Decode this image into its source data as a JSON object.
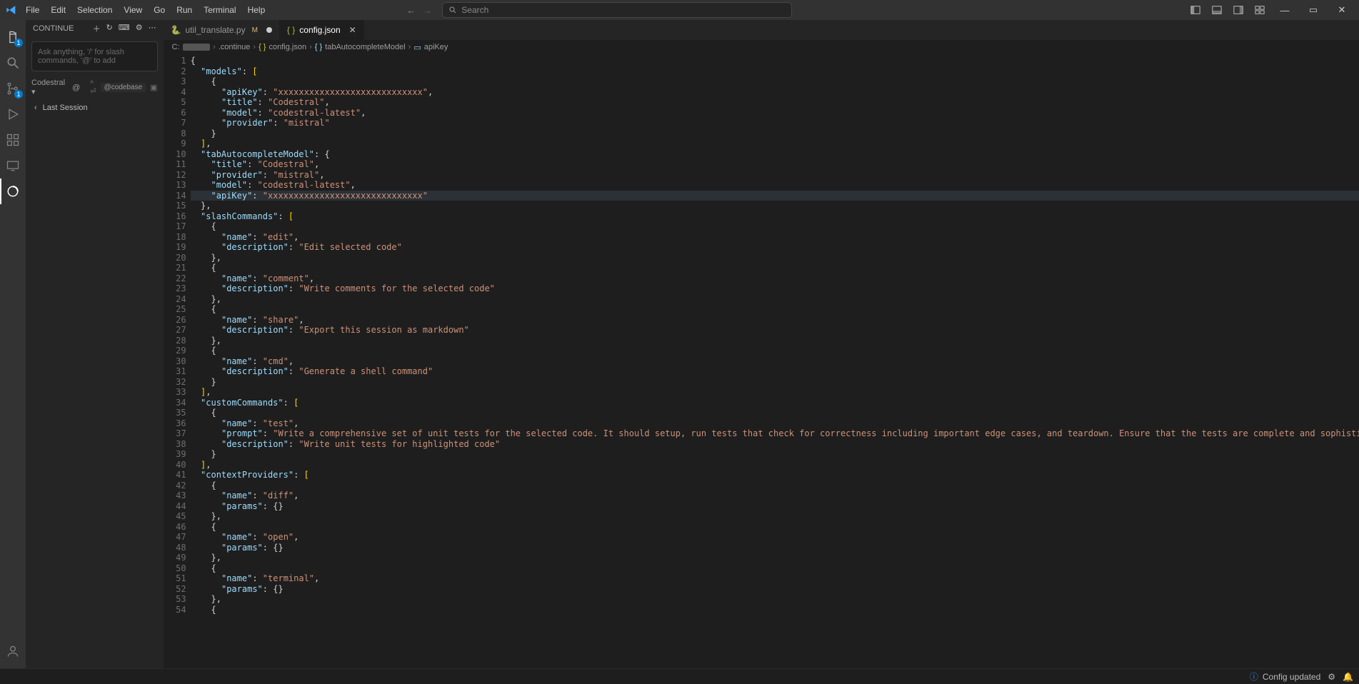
{
  "titlebar": {
    "menus": [
      "File",
      "Edit",
      "Selection",
      "View",
      "Go",
      "Run",
      "Terminal",
      "Help"
    ],
    "search_placeholder": "Search"
  },
  "activity": {
    "items": [
      {
        "name": "explorer-icon",
        "badge": "1"
      },
      {
        "name": "search-icon",
        "badge": null
      },
      {
        "name": "source-control-icon",
        "badge": "1"
      },
      {
        "name": "run-debug-icon",
        "badge": null
      },
      {
        "name": "extensions-icon",
        "badge": null
      },
      {
        "name": "remote-explorer-icon",
        "badge": null
      },
      {
        "name": "continue-icon",
        "badge": null
      }
    ]
  },
  "sidebar": {
    "title": "CONTINUE",
    "input_placeholder": "Ask anything, '/' for slash commands, '@' to add",
    "model": "Codestral",
    "codebase_chip": "@codebase",
    "history_label": "Last Session"
  },
  "tabs": [
    {
      "label": "util_translate.py",
      "modified": "M",
      "dirty": true,
      "active": false,
      "icon": "python"
    },
    {
      "label": "config.json",
      "modified": null,
      "dirty": false,
      "active": true,
      "icon": "json"
    }
  ],
  "breadcrumb": {
    "parts": [
      "C:",
      "",
      "›",
      ".continue",
      "›",
      "{} config.json",
      "›",
      "{} tabAutocompleteModel",
      "›",
      "▢ apiKey"
    ],
    "path1": "C:",
    "hidden": "█████",
    "p2": ".continue",
    "p3": "config.json",
    "p4": "tabAutocompleteModel",
    "p5": "apiKey"
  },
  "code": {
    "lines": [
      "{",
      "  \"models\": [",
      "    {",
      "      \"apiKey\": \"xxxxxxxxxxxxxxxxxxxxxxxxxxxx\",",
      "      \"title\": \"Codestral\",",
      "      \"model\": \"codestral-latest\",",
      "      \"provider\": \"mistral\"",
      "    }",
      "  ],",
      "  \"tabAutocompleteModel\": {",
      "    \"title\": \"Codestral\",",
      "    \"provider\": \"mistral\",",
      "    \"model\": \"codestral-latest\",",
      "    \"apiKey\": \"xxxxxxxxxxxxxxxxxxxxxxxxxxxxxx\"",
      "  },",
      "  \"slashCommands\": [",
      "    {",
      "      \"name\": \"edit\",",
      "      \"description\": \"Edit selected code\"",
      "    },",
      "    {",
      "      \"name\": \"comment\",",
      "      \"description\": \"Write comments for the selected code\"",
      "    },",
      "    {",
      "      \"name\": \"share\",",
      "      \"description\": \"Export this session as markdown\"",
      "    },",
      "    {",
      "      \"name\": \"cmd\",",
      "      \"description\": \"Generate a shell command\"",
      "    }",
      "  ],",
      "  \"customCommands\": [",
      "    {",
      "      \"name\": \"test\",",
      "      \"prompt\": \"Write a comprehensive set of unit tests for the selected code. It should setup, run tests that check for correctness including important edge cases, and teardown. Ensure that the tests are complete and sophisticated. Give the tests just as chat output, don't edit any file.\",",
      "      \"description\": \"Write unit tests for highlighted code\"",
      "    }",
      "  ],",
      "  \"contextProviders\": [",
      "    {",
      "      \"name\": \"diff\",",
      "      \"params\": {}",
      "    },",
      "    {",
      "      \"name\": \"open\",",
      "      \"params\": {}",
      "    },",
      "    {",
      "      \"name\": \"terminal\",",
      "      \"params\": {}",
      "    },",
      "    {"
    ],
    "current_line_index": 13
  },
  "status": {
    "message": "Config updated"
  }
}
